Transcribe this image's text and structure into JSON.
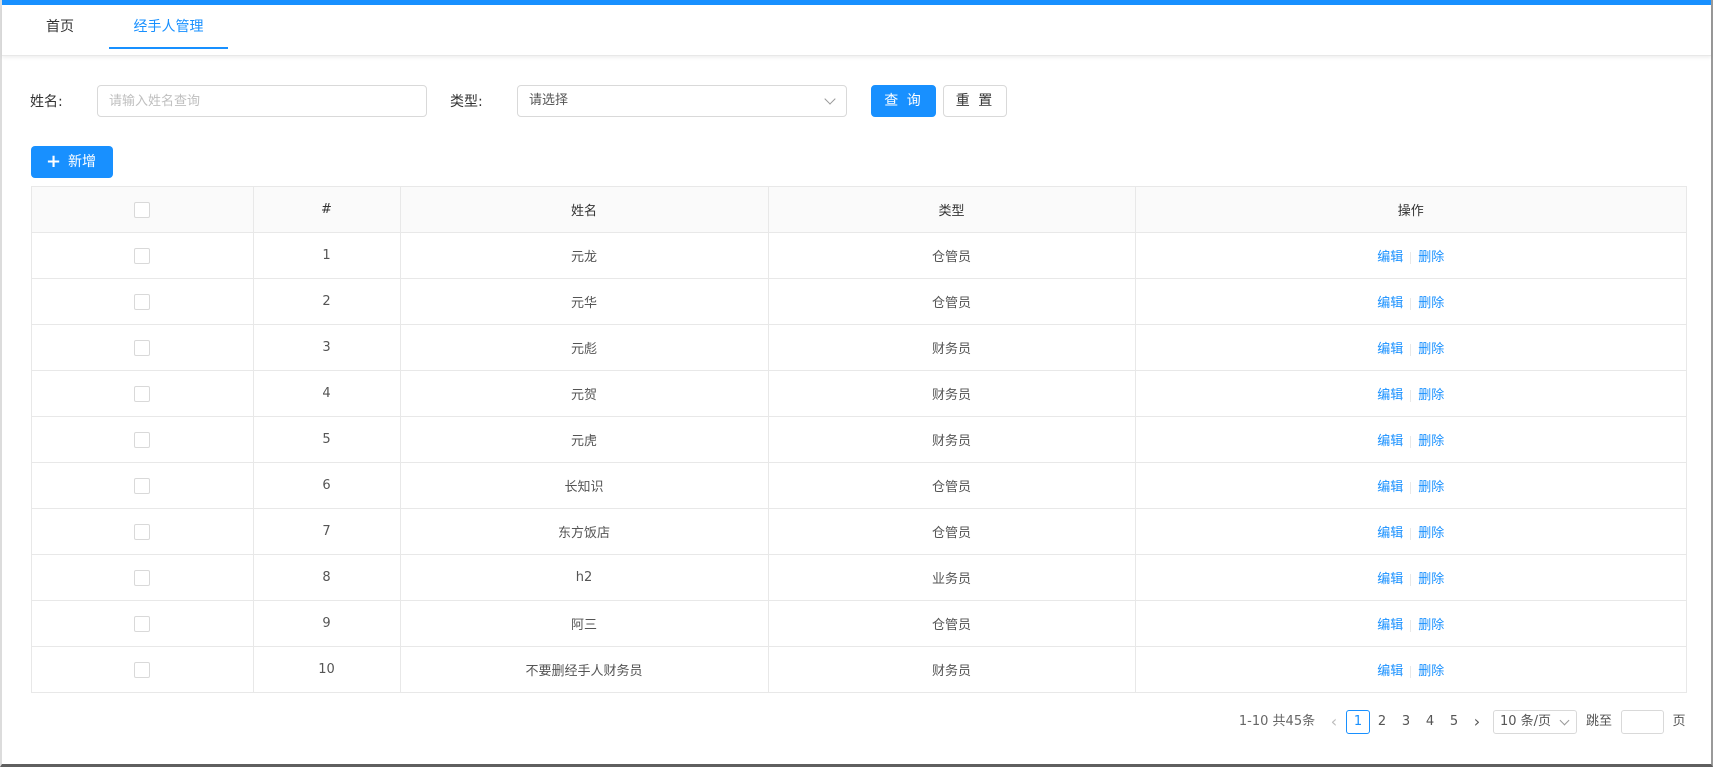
{
  "colors": {
    "primary": "#1890ff",
    "border": "#d9d9d9",
    "header_bg": "#fafafa"
  },
  "tabs": [
    {
      "label": "首页",
      "active": false
    },
    {
      "label": "经手人管理",
      "active": true
    }
  ],
  "search": {
    "name_label": "姓名:",
    "name_placeholder": "请输入姓名查询",
    "type_label": "类型:",
    "type_placeholder": "请选择",
    "query_button": "查 询",
    "reset_button": "重 置"
  },
  "toolbar": {
    "add_icon": "plus-icon",
    "add_label": "新增"
  },
  "table": {
    "columns": [
      "",
      "#",
      "姓名",
      "类型",
      "操作"
    ],
    "rows": [
      {
        "index": "1",
        "name": "元龙",
        "type": "仓管员"
      },
      {
        "index": "2",
        "name": "元华",
        "type": "仓管员"
      },
      {
        "index": "3",
        "name": "元彪",
        "type": "财务员"
      },
      {
        "index": "4",
        "name": "元贺",
        "type": "财务员"
      },
      {
        "index": "5",
        "name": "元虎",
        "type": "财务员"
      },
      {
        "index": "6",
        "name": "长知识",
        "type": "仓管员"
      },
      {
        "index": "7",
        "name": "东方饭店",
        "type": "仓管员"
      },
      {
        "index": "8",
        "name": "h2",
        "type": "业务员"
      },
      {
        "index": "9",
        "name": "阿三",
        "type": "仓管员"
      },
      {
        "index": "10",
        "name": "不要删经手人财务员",
        "type": "财务员"
      }
    ],
    "edit_label": "编辑",
    "delete_label": "删除"
  },
  "pagination": {
    "summary": "1-10 共45条",
    "prev_icon": "‹",
    "pages": [
      "1",
      "2",
      "3",
      "4",
      "5"
    ],
    "current_page": "1",
    "next_icon": "›",
    "page_size": "10 条/页",
    "jump_label": "跳至",
    "page_suffix": "页"
  }
}
